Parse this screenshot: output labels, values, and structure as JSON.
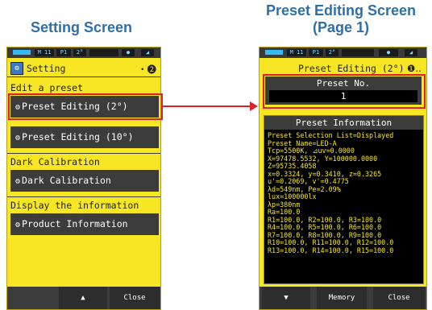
{
  "left_heading": "Setting Screen",
  "right_heading_line1": "Preset Editing Screen",
  "right_heading_line2": "(Page 1)",
  "left_screen": {
    "status": {
      "mode": "M 11",
      "preset": "P1",
      "angle": "2°"
    },
    "header_title": "Setting",
    "header_right": "・❷",
    "section_edit_preset": "Edit a preset",
    "btn_preset_2": "Preset Editing (2°)",
    "btn_preset_10": "Preset Editing (10°)",
    "section_dark": "Dark Calibration",
    "btn_dark": "Dark Calibration",
    "section_display": "Display the information",
    "btn_product": "Product Information",
    "bottom_up": "▲",
    "bottom_close": "Close"
  },
  "right_screen": {
    "status": {
      "mode": "M 11",
      "preset": "P1",
      "angle": "2°"
    },
    "header_title": "Preset Editing (2°)",
    "header_right": "❶‥",
    "preset_no_label": "Preset No.",
    "preset_no_value": "1",
    "info_title": "Preset Information",
    "info_lines": [
      "Preset Selection List=Displayed",
      "Preset Name=LED-A",
      "Tcp=5500K, ⊿uv=0.0000",
      "X=97478.5532, Y=100000.0000",
      "Z=95735.4058",
      "x=0.3324, y=0.3410, z=0.3265",
      "u'=0.2069, v'=0.4775",
      "λd=549nm, Pe=2.09%",
      "lux=100000lx",
      "λp=380nm",
      "Ra=100.0",
      "R1=100.0, R2=100.0, R3=100.0",
      "R4=100.0, R5=100.0, R6=100.0",
      "R7=100.0, R8=100.0, R9=100.0",
      "R10=100.0, R11=100.0, R12=100.0",
      "R13=100.0, R14=100.0, R15=100.0"
    ],
    "bottom_down": "▼",
    "bottom_memory": "Memory",
    "bottom_close": "Close"
  },
  "colors": {
    "accent_red": "#e0202a",
    "screen_yellow": "#f6e623",
    "heading_blue": "#2f6fa8"
  }
}
